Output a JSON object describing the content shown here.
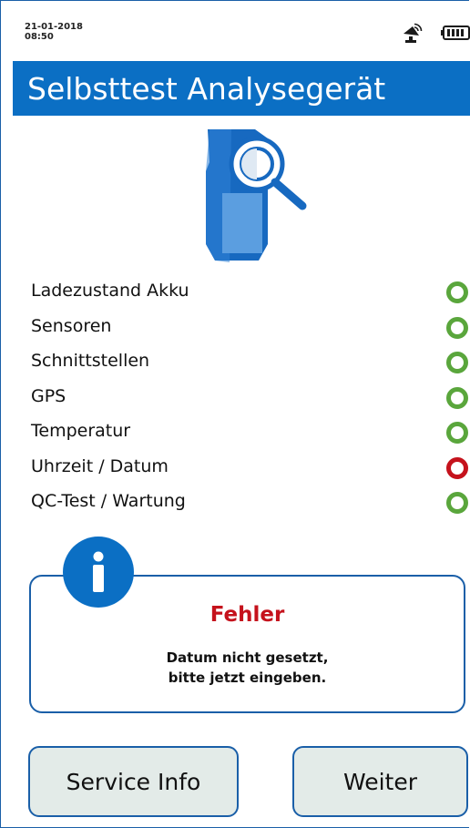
{
  "status": {
    "date": "21-01-2018",
    "time": "08:50",
    "icons": [
      "satellite-signal-icon",
      "battery-full-icon"
    ]
  },
  "title": "Selbsttest Analysegerät",
  "checks": [
    {
      "label": "Ladezustand Akku",
      "status": "ok"
    },
    {
      "label": "Sensoren",
      "status": "ok"
    },
    {
      "label": "Schnittstellen",
      "status": "ok"
    },
    {
      "label": "GPS",
      "status": "ok"
    },
    {
      "label": "Temperatur",
      "status": "ok"
    },
    {
      "label": "Uhrzeit / Datum",
      "status": "error"
    },
    {
      "label": "QC-Test / Wartung",
      "status": "ok"
    }
  ],
  "info": {
    "title": "Fehler",
    "message_line1": "Datum nicht gesetzt,",
    "message_line2": "bitte jetzt eingeben."
  },
  "buttons": {
    "service": "Service Info",
    "next": "Weiter"
  },
  "colors": {
    "brand": "#0b6fc4",
    "ok": "#5aa63c",
    "error": "#c5121c",
    "button_bg": "#e3ebe8"
  }
}
